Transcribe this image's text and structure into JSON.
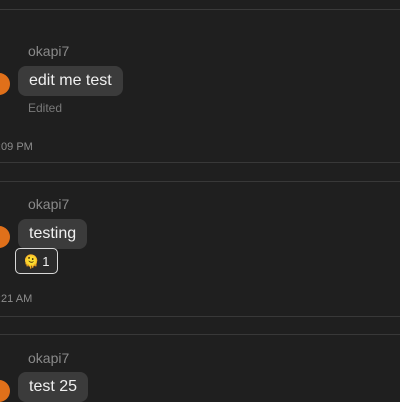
{
  "messages": [
    {
      "username": "okapi7",
      "text": "edit me test",
      "edited_label": "Edited",
      "timestamp": ":09 PM"
    },
    {
      "username": "okapi7",
      "text": "testing",
      "reaction": {
        "emoji": "🫠",
        "count": "1"
      },
      "timestamp": ":21 AM"
    },
    {
      "username": "okapi7",
      "text": "test 25"
    }
  ],
  "colors": {
    "background": "#1f1f1f",
    "bubble": "#3b3b3b",
    "avatar": "#e0701a"
  }
}
